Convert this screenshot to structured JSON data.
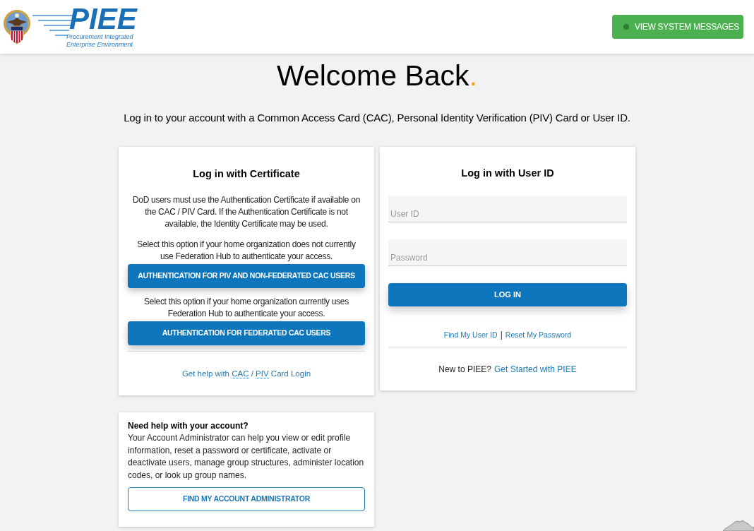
{
  "header": {
    "logo": {
      "wordmark": "PIEE",
      "tagline_lines": [
        "Procurement Integrated",
        "Enterprise Environment"
      ]
    },
    "system_messages_button": {
      "label": "VIEW SYSTEM MESSAGES"
    }
  },
  "welcome": {
    "title": "Welcome Back",
    "accent": ".",
    "subtitle": "Log in to your account with a Common Access Card (CAC), Personal Identity Verification (PIV) Card or User ID."
  },
  "certificate_card": {
    "title": "Log in with Certificate",
    "sections": [
      {
        "kind": "note",
        "text": "DoD users must use the Authentication Certificate if available on the CAC / PIV Card. If the Authentication Certificate is not available, the Identity Certificate may be used."
      },
      {
        "kind": "note",
        "text": "Select this option if your home organization does not currently use Federation Hub to authenticate your access."
      },
      {
        "kind": "button",
        "label": "AUTHENTICATION FOR PIV AND NON-FEDERATED CAC USERS"
      },
      {
        "kind": "note",
        "text": "Select this option if your home organization currently uses Federation Hub to authenticate your access."
      },
      {
        "kind": "button",
        "label": "AUTHENTICATION FOR FEDERATED CAC USERS"
      }
    ],
    "help_link": {
      "parts": [
        {
          "text": "Get help with ",
          "abbr": false
        },
        {
          "text": "CAC",
          "abbr": true
        },
        {
          "text": " / ",
          "abbr": false
        },
        {
          "text": "PIV",
          "abbr": true
        },
        {
          "text": " Card Login",
          "abbr": false
        }
      ]
    }
  },
  "user_id_card": {
    "title": "Log in with User ID",
    "fields": [
      {
        "placeholder": "User ID"
      },
      {
        "placeholder": "Password"
      }
    ],
    "login_button": "LOG IN",
    "links": [
      "Find My User ID",
      "Reset My Password"
    ],
    "separator": "|",
    "signup": {
      "prompt": "New to PIEE?",
      "link": "Get Started with PIEE"
    }
  },
  "account_help_card": {
    "title": "Need help with your account?",
    "text": "Your Account Administrator can help you view or edit profile information, reset a password or certificate, activate or deactivate users, manage group structures, administer location codes, or look up group names.",
    "button": "FIND MY ACCOUNT ADMINISTRATOR"
  }
}
